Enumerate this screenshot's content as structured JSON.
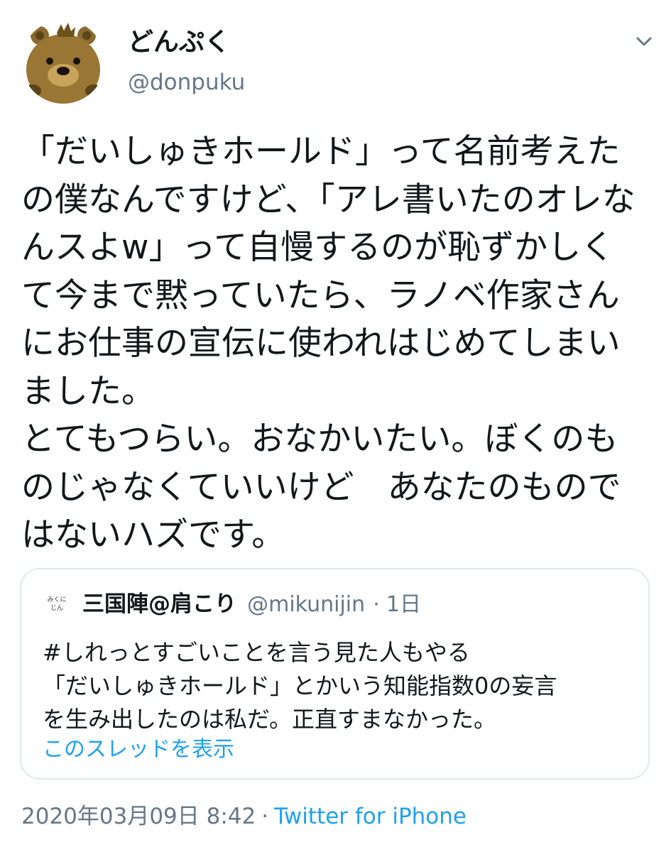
{
  "author": {
    "display_name": "どんぷく",
    "handle": "@donpuku",
    "avatar_icon": "bear-avatar"
  },
  "tweet": {
    "text": "「だいしゅきホールド」って名前考えたの僕なんですけど、「アレ書いたのオレなんスよw」って自慢するのが恥ずかしくて今まで黙っていたら、ラノベ作家さんにお仕事の宣伝に使われはじめてしまいました。\nとてもつらい。おなかいたい。ぼくのものじゃなくていいけど　あなたのものではないハズです。"
  },
  "quoted_tweet": {
    "avatar_text_line1": "みくに",
    "avatar_text_line2": "じん",
    "display_name": "三国陣@肩こり",
    "handle": "@mikunijin",
    "separator": "·",
    "time": "1日",
    "text": "#しれっとすごいことを言う見た人もやる\n「だいしゅきホールド」とかいう知能指数0の妄言\nを生み出したのは私だ。正直すまなかった。",
    "show_thread_label": "このスレッドを表示"
  },
  "meta": {
    "timestamp": "2020年03月09日 8:42",
    "separator": "·",
    "source": "Twitter for iPhone"
  },
  "colors": {
    "text": "#14171a",
    "secondary": "#657786",
    "link": "#1da1f2",
    "border": "#e1e8ed"
  }
}
